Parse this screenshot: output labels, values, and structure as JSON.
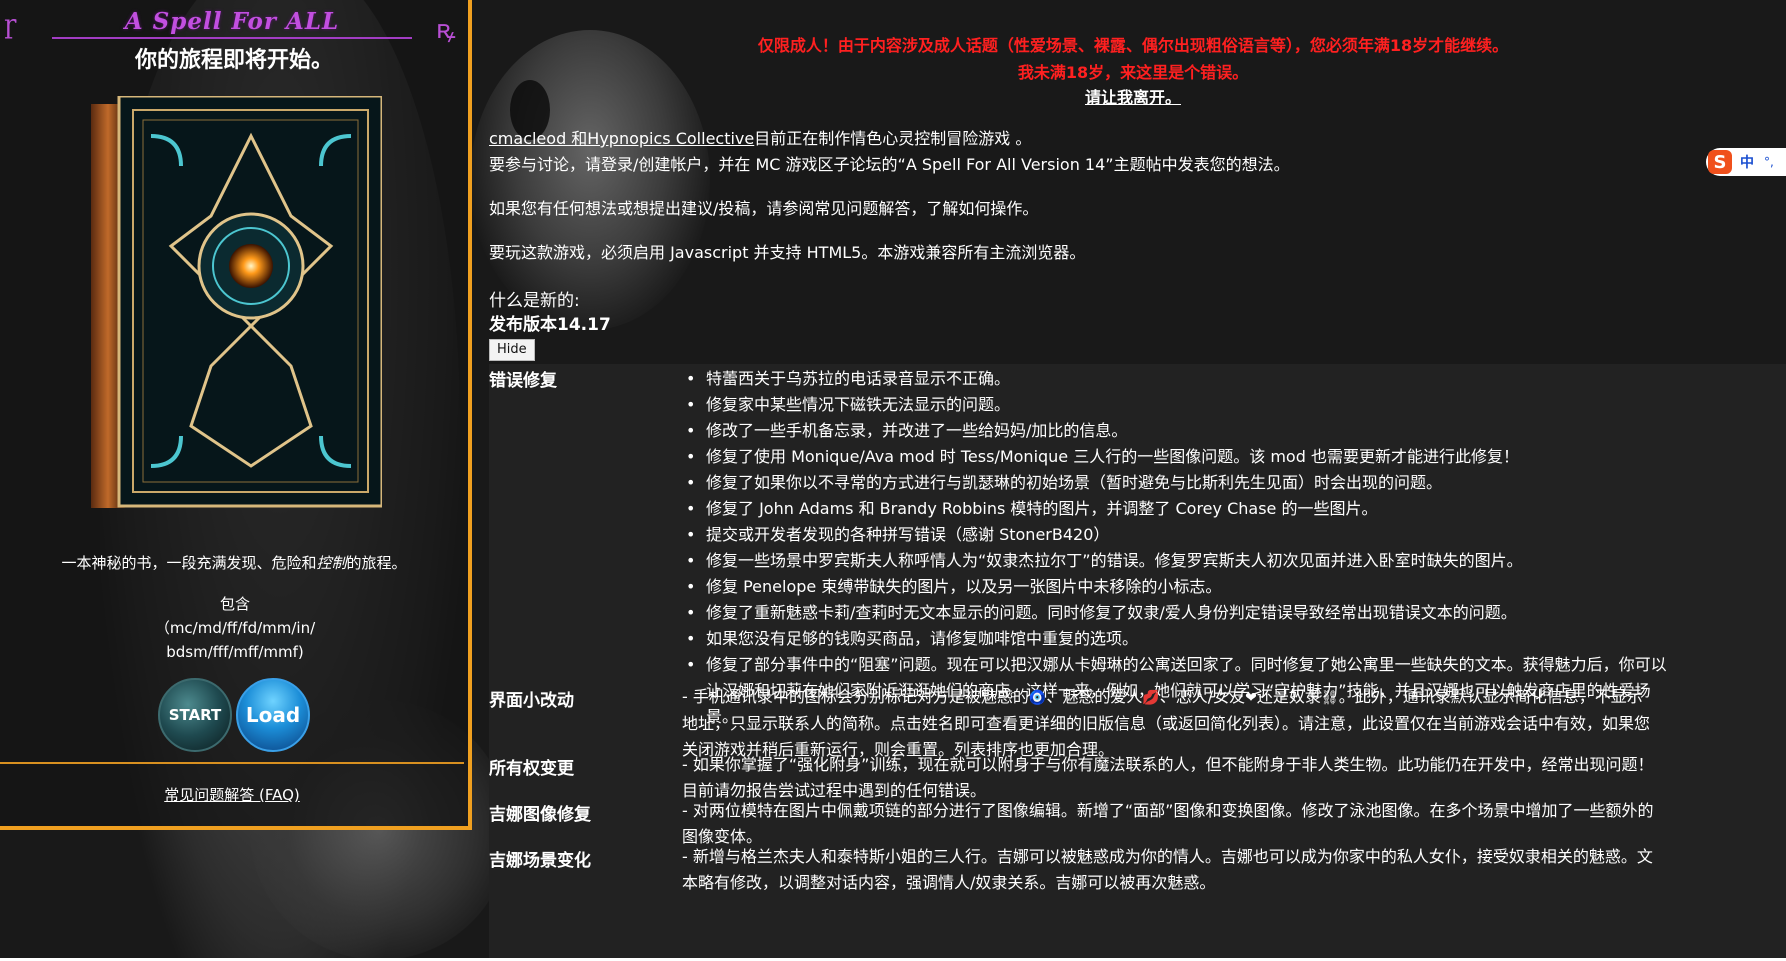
{
  "sidebar": {
    "logo_title": "A Spell For ALL",
    "journey": "你的旅程即将开始。",
    "tagline_pre": "一本神秘的书，一段充满发现、危险和",
    "tagline_em": "控制",
    "tagline_post": "的旅程。",
    "contains_label": "包含",
    "contains_line1": "（mc/md/ff/fd/mm/in/",
    "contains_line2": "bdsm/fff/mff/mmf)",
    "start_label": "START",
    "load_label": "Load",
    "faq_link": "常见问题解答 (FAQ)"
  },
  "warning": {
    "line1": "仅限成人！由于内容涉及成人话题（性爱场景、裸露、偶尔出现粗俗语言等），您必须年满18岁才能继续。",
    "line2": "我未满18岁，来这里是个错误。",
    "leave_link": "请让我离开。"
  },
  "intro": {
    "author_link": "cmacleod 和Hypnopics Collective",
    "author_rest": "目前正在制作情色心灵控制冒险游戏 。",
    "discuss": "要参与讨论，请登录/创建帐户，并在 MC 游戏区子论坛的“A Spell For All Version 14”主题帖中发表您的想法。",
    "suggest": "如果您有任何想法或想提出建议/投稿，请参阅常见问题解答，了解如何操作。",
    "requirements": "要玩这款游戏，必须启用 Javascript 并支持 HTML5。本游戏兼容所有主流浏览器。"
  },
  "ime": {
    "logo": "S",
    "mode": "中",
    "punct": "°,"
  },
  "whatsnew": {
    "label": "什么是新的:",
    "version": "发布版本14.17",
    "hide_button": "Hide"
  },
  "changelog": {
    "bugfix_title": "错误修复",
    "bugfixes": [
      "特蕾西关于乌苏拉的电话录音显示不正确。",
      "修复家中某些情况下磁铁无法显示的问题。",
      "修改了一些手机备忘录，并改进了一些给妈妈/加比的信息。",
      "修复了使用 Monique/Ava mod 时 Tess/Monique 三人行的一些图像问题。该 mod 也需要更新才能进行此修复！",
      "修复了如果你以不寻常的方式进行与凯瑟琳的初始场景（暂时避免与比斯利先生见面）时会出现的问题。",
      "修复了 John Adams 和 Brandy Robbins 模特的图片，并调整了 Corey Chase 的一些图片。",
      "提交或开发者发现的各种拼写错误（感谢 StonerB420）",
      "修复一些场景中罗宾斯夫人称呼情人为“奴隶杰拉尔丁”的错误。修复罗宾斯夫人初次见面并进入卧室时缺失的图片。",
      "修复 Penelope 束缚带缺失的图片，以及另一张图片中未移除的小标志。",
      "修复了重新魅惑卡莉/查莉时无文本显示的问题。同时修复了奴隶/爱人身份判定错误导致经常出现错误文本的问题。",
      "如果您没有足够的钱购买商品，请修复咖啡馆中重复的选项。"
    ],
    "bugfix_long_1": "修复了部分事件中的“阻塞”问题。现在可以把汉娜从卡姆琳的公寓送回家了。同时修复了她公寓里一些缺失的文本。获得魅力后，你可以",
    "bugfix_long_2": "让汉娜和切莉在她们家附近逛逛她们的商店。这样一来，例如，她们就可以学习“守护魅力”技能，并且汉娜也可以触发商店里的性爱场",
    "bugfix_long_3": "景。",
    "ui_title": "界面小改动",
    "ui_1a": "- 手机通讯录中的图标会分别标记对方是被魅惑的",
    "ui_1b": "、魅惑的爱人",
    "ui_1c": "、恋人/女友",
    "ui_1d": "还是奴隶",
    "ui_1e": "。此外，通讯录默认显示简化信息，不显示",
    "ui_2": "地址，只显示联系人的简称。点击姓名即可查看更详细的旧版信息（或返回简化列表）。请注意，此设置仅在当前游戏会话中有效，如果您",
    "ui_3": "关闭游戏并稍后重新运行，则会重置。列表排序也更加合理。",
    "ownership_title": "所有权变更",
    "ownership_1": "- 如果你掌握了“强化附身”训练，现在就可以附身于与你有魔法联系的人，但不能附身于非人类生物。此功能仍在开发中，经常出现问题！",
    "ownership_2": "目前请勿报告尝试过程中遇到的任何错误。",
    "gina_img_title": "吉娜图像修复",
    "gina_img_1": "- 对两位模特在图片中佩戴项链的部分进行了图像编辑。新增了“面部”图像和变换图像。修改了泳池图像。在多个场景中增加了一些额外的",
    "gina_img_2": "图像变体。",
    "gina_scene_title": "吉娜场景变化",
    "gina_scene_1": "- 新增与格兰杰夫人和泰特斯小姐的三人行。吉娜可以被魅惑成为你的情人。吉娜也可以成为你家中的私人女仆，接受奴隶相关的魅惑。文",
    "gina_scene_2": "本略有修改，以调整对话内容，强调情人/奴隶关系。吉娜可以被再次魅惑。"
  },
  "colors": {
    "accent_orange": "#f0a020",
    "warning_red": "#ff2020",
    "logo_purple": "#c24fe0"
  }
}
